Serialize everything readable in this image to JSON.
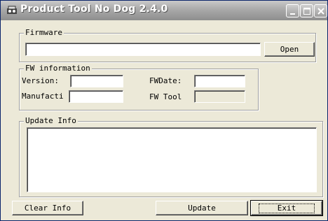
{
  "window": {
    "title": "Product Tool No Dog 2.4.0",
    "icon": "app-icon"
  },
  "firmware": {
    "group_label": "Firmware",
    "path_value": "",
    "open_label": "Open"
  },
  "fw_info": {
    "group_label": "FW information",
    "version_label": "Version:",
    "version_value": "",
    "manufacturer_label": "Manufacti",
    "manufacturer_value": "",
    "fwdate_label": "FWDate:",
    "fwdate_value": "",
    "fwtool_label": "FW Tool",
    "fwtool_value": ""
  },
  "update_info": {
    "group_label": "Update Info",
    "text": ""
  },
  "buttons": {
    "clear_info": "Clear Info",
    "update": "Update",
    "exit": "Exit"
  }
}
